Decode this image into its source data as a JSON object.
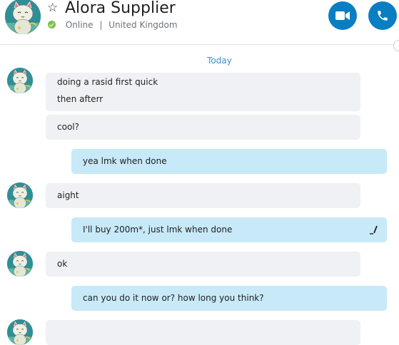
{
  "contact": {
    "name": "Alora Supplier",
    "status": "Online",
    "location": "United Kingdom",
    "separator": "|",
    "status_color": "#7cc243"
  },
  "header": {
    "favorite_icon": "star-outline-icon",
    "video_call_icon": "video-camera-icon",
    "audio_call_icon": "phone-icon",
    "call_button_color": "#0a7ec2"
  },
  "conversation": {
    "date_label": "Today",
    "messages": [
      {
        "direction": "incoming",
        "lines": [
          "doing a rasid first quick",
          "then afterr"
        ]
      },
      {
        "direction": "incoming",
        "lines": [
          "cool?"
        ]
      },
      {
        "direction": "outgoing",
        "lines": [
          "yea lmk when done"
        ]
      },
      {
        "direction": "incoming",
        "lines": [
          "aight"
        ]
      },
      {
        "direction": "outgoing",
        "lines": [
          "I'll buy 200m*, just lmk when done"
        ],
        "edited_icon": "edit-pencil-icon"
      },
      {
        "direction": "incoming",
        "lines": [
          "ok"
        ]
      },
      {
        "direction": "outgoing",
        "lines": [
          "can you do it now or? how long you think?"
        ]
      }
    ]
  },
  "colors": {
    "incoming_bubble": "#eff1f4",
    "outgoing_bubble": "#c7e9f8",
    "date_label": "#3a8fc8"
  }
}
